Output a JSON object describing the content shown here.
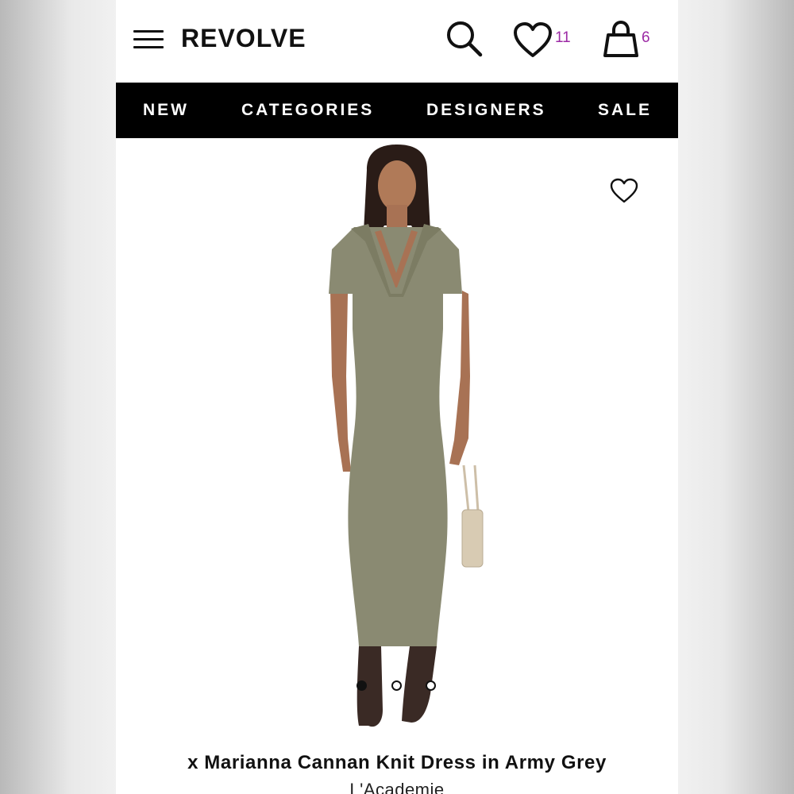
{
  "header": {
    "logo": "REVOLVE",
    "wishlist_count": "11",
    "bag_count": "6",
    "icons": [
      "menu-icon",
      "search-icon",
      "heart-icon",
      "shopping-bag-icon"
    ],
    "count_color": "#9c2aa5"
  },
  "nav": {
    "items": [
      {
        "label": "NEW"
      },
      {
        "label": "CATEGORIES"
      },
      {
        "label": "DESIGNERS"
      },
      {
        "label": "SALE"
      }
    ],
    "background": "#000000"
  },
  "product": {
    "title": "x Marianna Cannan Knit Dress in Army Grey",
    "brand": "L'Academie",
    "image_count": 3,
    "active_image": 1,
    "dress_color": "#8a8a72"
  }
}
